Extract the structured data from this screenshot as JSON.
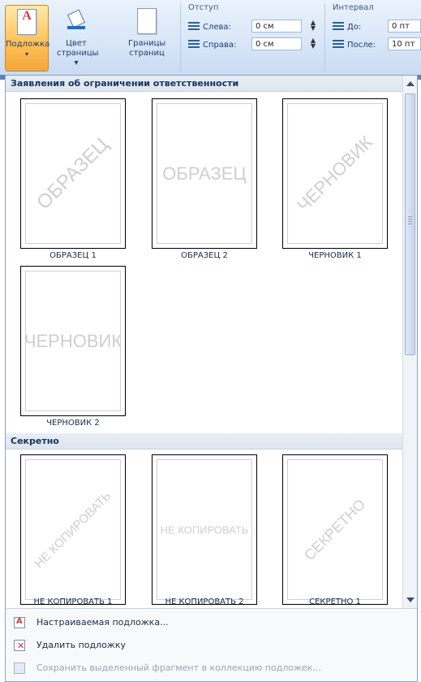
{
  "ribbon": {
    "watermark_btn": {
      "line1": "Подложка",
      "arrow": "▾"
    },
    "page_color_btn": {
      "line1": "Цвет",
      "line2": "страницы ▾"
    },
    "page_borders_btn": {
      "line1": "Границы",
      "line2": "страниц"
    },
    "indent": {
      "title": "Отступ",
      "left_label": "Слева:",
      "left_value": "0 см",
      "right_label": "Справа:",
      "right_value": "0 см"
    },
    "spacing": {
      "title": "Интервал",
      "before_label": "До:",
      "before_value": "0 пт",
      "after_label": "После:",
      "after_value": "10 пт"
    }
  },
  "gallery": {
    "sections": [
      {
        "title": "Заявления об ограничении ответственности",
        "items": [
          {
            "label": "ОБРАЗЕЦ 1",
            "watermark": "ОБРАЗЕЦ"
          },
          {
            "label": "ОБРАЗЕЦ 2",
            "watermark": "ОБРАЗЕЦ"
          },
          {
            "label": "ЧЕРНОВИК 1",
            "watermark": "ЧЕРНОВИК"
          },
          {
            "label": "ЧЕРНОВИК 2",
            "watermark": "ЧЕРНОВИК"
          }
        ]
      },
      {
        "title": "Секретно",
        "items": [
          {
            "label": "НЕ КОПИРОВАТЬ 1",
            "watermark": "НЕ КОПИРОВАТЬ"
          },
          {
            "label": "НЕ КОПИРОВАТЬ 2",
            "watermark": "НЕ КОПИРОВАТЬ"
          },
          {
            "label": "СЕКРЕТНО 1",
            "watermark": "СЕКРЕТНО"
          }
        ]
      }
    ]
  },
  "menu": {
    "custom": "Настраиваемая подложка...",
    "remove": "Удалить подложку",
    "save_selection": "Сохранить выделенный фрагмент в коллекцию подложек..."
  }
}
